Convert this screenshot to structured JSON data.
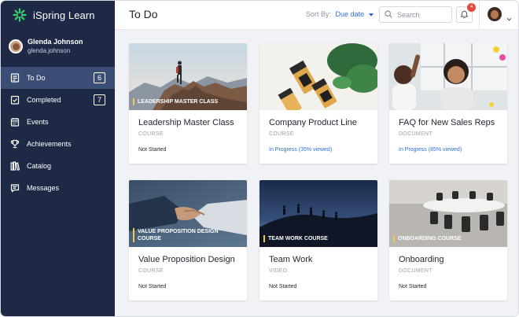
{
  "app": {
    "name": "iSpring Learn"
  },
  "user": {
    "name": "Glenda Johnson",
    "login": "glenda.johnson"
  },
  "nav": [
    {
      "label": "To Do",
      "count": "6",
      "icon": "todo-icon"
    },
    {
      "label": "Completed",
      "count": "7",
      "icon": "completed-icon"
    },
    {
      "label": "Events",
      "count": null,
      "icon": "calendar-icon"
    },
    {
      "label": "Achievements",
      "count": null,
      "icon": "trophy-icon"
    },
    {
      "label": "Catalog",
      "count": null,
      "icon": "catalog-icon"
    },
    {
      "label": "Messages",
      "count": null,
      "icon": "messages-icon"
    }
  ],
  "header": {
    "title": "To Do",
    "sort_label": "Sort By:",
    "sort_value": "Due date",
    "search_placeholder": "Search",
    "notification_count": "4"
  },
  "cards": [
    {
      "overlay": "LEADERSHIP MASTER CLASS",
      "title": "Leadership Master Class",
      "type": "COURSE",
      "status": "Not Started",
      "in_progress": false
    },
    {
      "overlay": "",
      "title": "Company Product Line",
      "type": "COURSE",
      "status": "In Progress (35% viewed)",
      "in_progress": true
    },
    {
      "overlay": "",
      "title": "FAQ for New Sales Reps",
      "type": "DOCUMENT",
      "status": "In Progress (85% viewed)",
      "in_progress": true
    },
    {
      "overlay": "VALUE PROPOSITION DESIGN COURSE",
      "title": "Value Proposition Design",
      "type": "COURSE",
      "status": "Not Started",
      "in_progress": false
    },
    {
      "overlay": "TEAM WORK COURSE",
      "title": "Team Work",
      "type": "VIDEO",
      "status": "Not Started",
      "in_progress": false
    },
    {
      "overlay": "ONBOARDING COURSE",
      "title": "Onboarding",
      "type": "DOCUMENT",
      "status": "Not Started",
      "in_progress": false
    }
  ],
  "colors": {
    "sidebar": "#1e2a45",
    "active_nav": "#3c4e75",
    "accent": "#2f6fd6",
    "badge": "#e5483b",
    "overlay_bar": "#f2c94c",
    "logo": "#3ecf6d"
  }
}
